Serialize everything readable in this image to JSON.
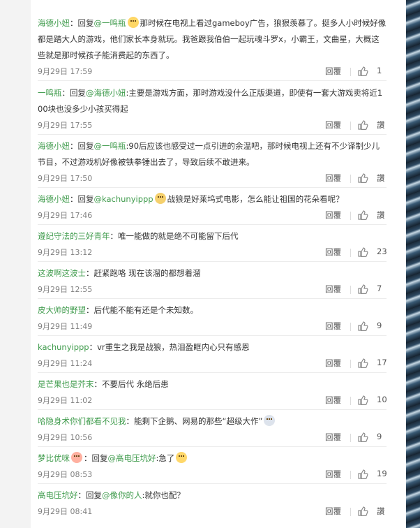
{
  "ui": {
    "reply_label": "回覆",
    "like_placeholder": "讚"
  },
  "comments": [
    {
      "user": "海德小妞",
      "body_prefix": "：回复",
      "mention": "@一鸣瓶",
      "emoji1": "sad-emoji",
      "text": "那时候在电视上看过gameboy广告，狼狠羡慕了。挺多人小时候好像都是踏大人的游戏，他们家长本身就玩。我爸跟我伯伯一起玩魂斗罗x，小霸王，文曲星，大概这些就是那时候孩子能消费起的东西了。",
      "time": "9月29日 17:59",
      "likes": "1"
    },
    {
      "user": "一鸣瓶",
      "body_prefix": "：回复",
      "mention": "@海德小妞",
      "text": ":主要是游戏方面，那时游戏没什么正版渠道，即使有一套大游戏卖将近100块也没多少小孩买得起",
      "time": "9月29日 17:55",
      "likes": "讚"
    },
    {
      "user": "海德小妞",
      "body_prefix": "：回复",
      "mention": "@一鸣瓶",
      "text": ":90后应该也感受过一点引进的余温吧，那时候电视上还有不少译制少儿节目，不过游戏机好像被铁拳锤出去了，导致后续不敢进来。",
      "time": "9月29日 17:50",
      "likes": "讚"
    },
    {
      "user": "海德小妞",
      "body_prefix": "：回复",
      "mention": "@kachunyippp",
      "emoji1": "cat-emoji",
      "text": "战狼是好莱坞式电影，怎么能让祖国的花朵看呢？",
      "time": "9月29日 17:46",
      "likes": "讚"
    },
    {
      "user": "遵纪守法的三好青年",
      "text": "：唯一能做的就是绝不可能留下后代",
      "time": "9月29日 13:12",
      "likes": "23"
    },
    {
      "user": "这波啊这波士",
      "text": "：赶紧跑咯 现在该溜的都想着溜",
      "time": "9月29日 12:55",
      "likes": "7"
    },
    {
      "user": "皮大帅的野望",
      "text": "：后代能不能有还是个未知数。",
      "time": "9月29日 11:49",
      "likes": "9"
    },
    {
      "user": "kachunyippp",
      "text": "：vr重生之我是战狼，热泪盈眶内心只有感恩",
      "time": "9月29日 11:24",
      "likes": "17"
    },
    {
      "user": "是芒果也是芥末",
      "text": "：不要后代 永绝后患",
      "time": "9月29日 11:02",
      "likes": "10"
    },
    {
      "user": "哈隐身术你们都看不见我",
      "text": "：能剩下企鹅、网易的那些“超级大作”",
      "emoji2": "shock-emoji",
      "time": "9月29日 10:56",
      "likes": "9"
    },
    {
      "user": "梦比优咪",
      "emoji_after_user": "shy-emoji",
      "body_prefix": "：回复",
      "mention": "@高电压坑好",
      "text": ":急了",
      "emoji2": "smile-emoji",
      "time": "9月29日 08:53",
      "likes": "19"
    },
    {
      "user": "高电压坑好",
      "body_prefix": "：回复",
      "mention": "@像你的人",
      "text": ":就你也配？",
      "time": "9月29日 08:41",
      "likes": "讚"
    }
  ]
}
